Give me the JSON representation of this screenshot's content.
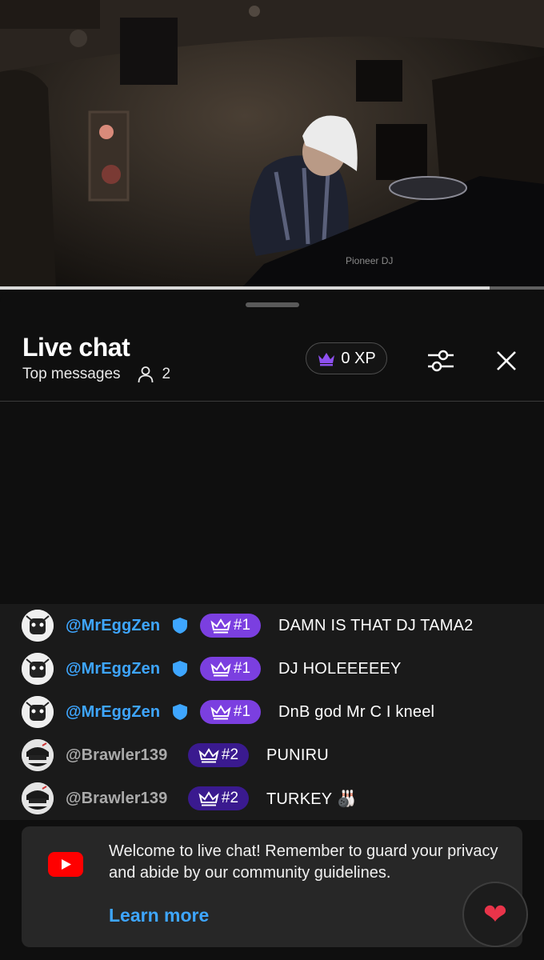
{
  "video": {
    "progress_fraction": 0.9,
    "brand_text": "Pioneer DJ"
  },
  "chat_panel": {
    "title": "Live chat",
    "mode_label": "Top messages",
    "viewer_count": "2",
    "xp_label": "0 XP",
    "icons": {
      "xp": "crown-icon",
      "viewers": "person-icon",
      "filters": "sliders-icon",
      "close": "close-icon"
    }
  },
  "messages": [
    {
      "author": "@MrEggZen",
      "verified": true,
      "rank": "#1",
      "text": "DAMN IS THAT DJ TAMA2"
    },
    {
      "author": "@MrEggZen",
      "verified": true,
      "rank": "#1",
      "text": "DJ HOLEEEEEY"
    },
    {
      "author": "@MrEggZen",
      "verified": true,
      "rank": "#1",
      "text": "DnB god Mr C I kneel"
    },
    {
      "author": "@Brawler139",
      "verified": false,
      "rank": "#2",
      "text": "PUNIRU"
    },
    {
      "author": "@Brawler139",
      "verified": false,
      "rank": "#2",
      "text": "TURKEY 🎳"
    }
  ],
  "welcome": {
    "text": "Welcome to live chat! Remember to guard your privacy and abide by our community guidelines.",
    "link": "Learn more"
  },
  "heart_button": {
    "icon": "heart-icon",
    "glyph": "❤"
  },
  "colors": {
    "accent_blue": "#3ea6ff",
    "rank1_purple": "#7b3fe0",
    "rank2_purple": "#3a1a8f",
    "youtube_red": "#ff0000"
  }
}
